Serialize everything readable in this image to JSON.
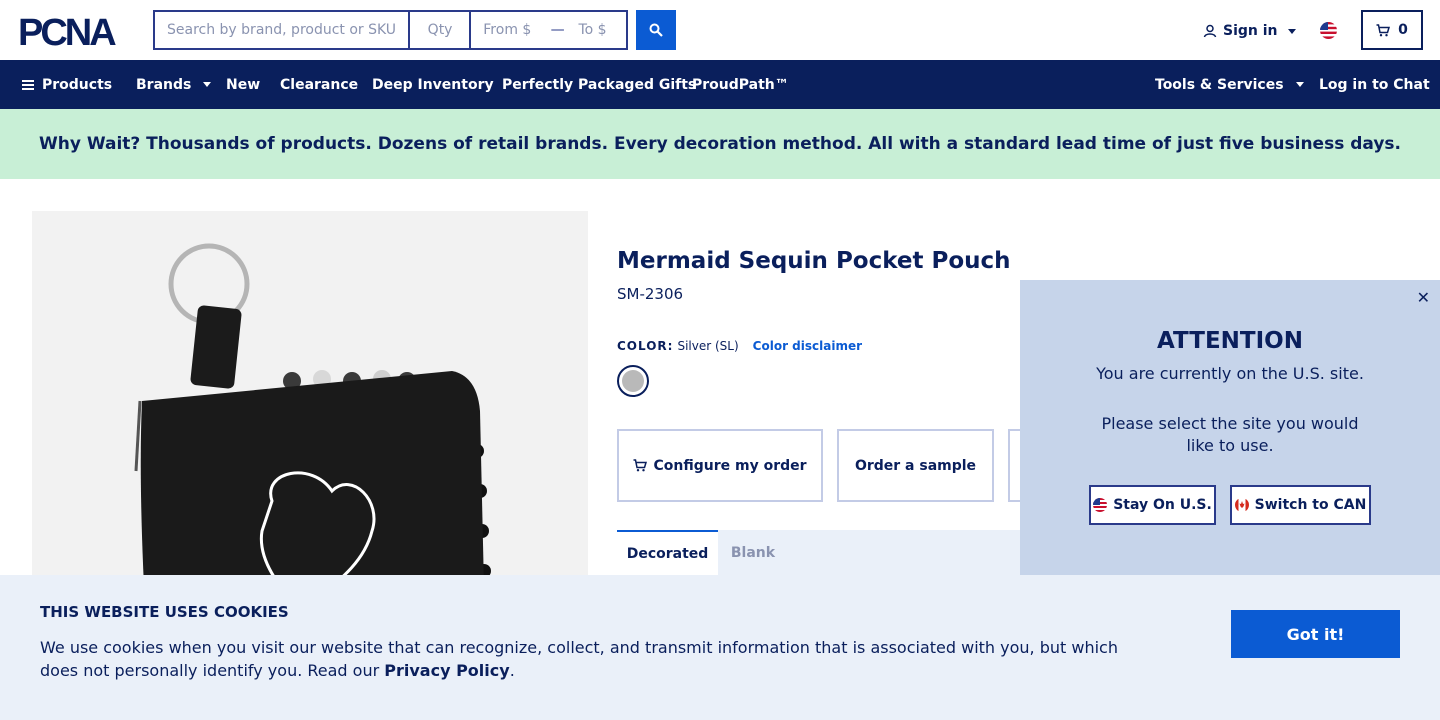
{
  "header": {
    "logo_text": "PCNA",
    "search_placeholder": "Search by brand, product or SKU",
    "qty_placeholder": "Qty",
    "from_placeholder": "From $",
    "range_dash": "—",
    "to_placeholder": "To $",
    "sign_in": "Sign in",
    "cart_count": "0"
  },
  "nav": {
    "items": [
      {
        "label": "Products"
      },
      {
        "label": "Brands"
      },
      {
        "label": "New"
      },
      {
        "label": "Clearance"
      },
      {
        "label": "Deep Inventory"
      },
      {
        "label": "Perfectly Packaged Gifts"
      },
      {
        "label": "ProudPath™"
      }
    ],
    "tools": "Tools & Services",
    "chat": "Log in to Chat"
  },
  "promo": "Why Wait? Thousands of products. Dozens of retail brands. Every decoration method. All with a standard lead time of just five business days.",
  "product": {
    "title": "Mermaid Sequin Pocket Pouch",
    "sku": "SM-2306",
    "color_label": "COLOR:",
    "color_value": "Silver (SL)",
    "color_disclaimer": "Color disclaimer",
    "swatch_color": "#b9b9b9",
    "configure": "Configure my order",
    "sample": "Order a sample",
    "tabs": [
      "Decorated",
      "Blank"
    ]
  },
  "attention": {
    "title": "ATTENTION",
    "line1": "You are currently on the U.S. site.",
    "line2": "Please select the site you would like to use.",
    "stay": "Stay On U.S.",
    "switch": "Switch to CAN"
  },
  "cookies": {
    "title": "THIS WEBSITE USES COOKIES",
    "text": "We use cookies when you visit our website that can recognize, collect, and transmit information that is associated with you, but which does not personally identify you. Read our",
    "link": "Privacy Policy",
    "end": ".",
    "button": "Got it!"
  },
  "colors": {
    "navy": "#0a1f5c",
    "accent": "#0b5bd3",
    "promo_bg": "#c8efd6"
  }
}
